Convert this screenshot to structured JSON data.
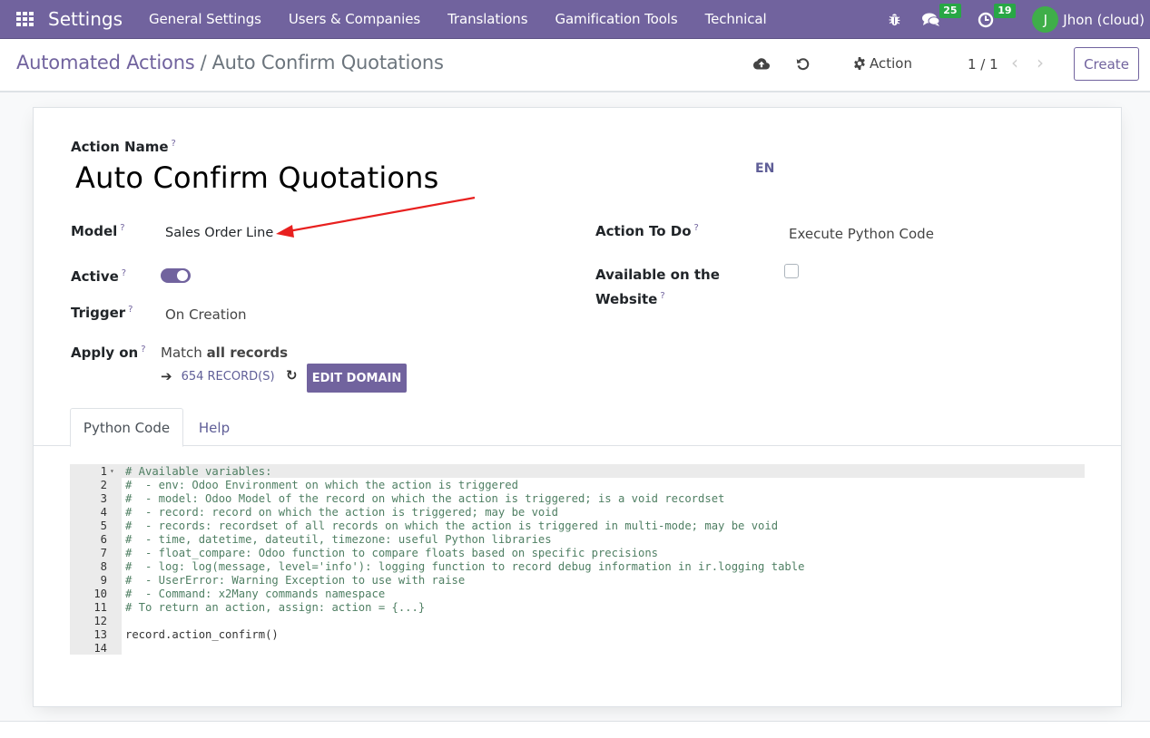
{
  "navbar": {
    "app_name": "Settings",
    "menu": [
      "General Settings",
      "Users & Companies",
      "Translations",
      "Gamification Tools",
      "Technical"
    ],
    "messages_count": "25",
    "activities_count": "19",
    "user_initial": "J",
    "user_name": "Jhon (cloud)",
    "colors": {
      "brand": "#71639e",
      "badge": "#28a745",
      "avatar": "#3fae49"
    }
  },
  "control_panel": {
    "breadcrumb_parent": "Automated Actions",
    "breadcrumb_separator": "/",
    "breadcrumb_current": "Auto Confirm Quotations",
    "action_label": "Action",
    "pager": "1 / 1",
    "create_label": "Create"
  },
  "form": {
    "action_name_label": "Action Name",
    "action_name_value": "Auto Confirm Quotations",
    "lang": "EN",
    "help_mark": "?",
    "model_label": "Model",
    "model_value": "Sales Order Line",
    "active_label": "Active",
    "active_value": true,
    "trigger_label": "Trigger",
    "trigger_value": "On Creation",
    "apply_on_label": "Apply on",
    "apply_on_prefix": "Match",
    "apply_on_bold": "all records",
    "records_count": "654 RECORD(S)",
    "edit_domain_label": "EDIT DOMAIN",
    "action_to_do_label": "Action To Do",
    "action_to_do_value": "Execute Python Code",
    "website_label_1": "Available on the",
    "website_label_2": "Website",
    "website_value": false
  },
  "tabs": [
    {
      "label": "Python Code",
      "active": true
    },
    {
      "label": "Help",
      "active": false
    }
  ],
  "code_lines": [
    {
      "n": "1",
      "text": "# Available variables:",
      "comment": true
    },
    {
      "n": "2",
      "text": "#  - env: Odoo Environment on which the action is triggered",
      "comment": true
    },
    {
      "n": "3",
      "text": "#  - model: Odoo Model of the record on which the action is triggered; is a void recordset",
      "comment": true
    },
    {
      "n": "4",
      "text": "#  - record: record on which the action is triggered; may be void",
      "comment": true
    },
    {
      "n": "5",
      "text": "#  - records: recordset of all records on which the action is triggered in multi-mode; may be void",
      "comment": true
    },
    {
      "n": "6",
      "text": "#  - time, datetime, dateutil, timezone: useful Python libraries",
      "comment": true
    },
    {
      "n": "7",
      "text": "#  - float_compare: Odoo function to compare floats based on specific precisions",
      "comment": true
    },
    {
      "n": "8",
      "text": "#  - log: log(message, level='info'): logging function to record debug information in ir.logging table",
      "comment": true
    },
    {
      "n": "9",
      "text": "#  - UserError: Warning Exception to use with raise",
      "comment": true
    },
    {
      "n": "10",
      "text": "#  - Command: x2Many commands namespace",
      "comment": true
    },
    {
      "n": "11",
      "text": "# To return an action, assign: action = {...}",
      "comment": true
    },
    {
      "n": "12",
      "text": "",
      "comment": false
    },
    {
      "n": "13",
      "text": "record.action_confirm()",
      "comment": false
    },
    {
      "n": "14",
      "text": "",
      "comment": false
    }
  ]
}
